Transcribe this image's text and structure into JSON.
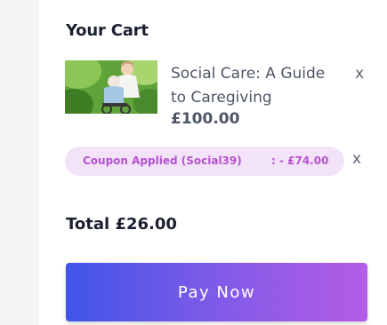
{
  "cart": {
    "title": "Your Cart",
    "item": {
      "name": "Social Care: A Guide to Caregiving",
      "price": "£100.00",
      "remove_label": "x",
      "image_icon": "caregiver-photo"
    },
    "coupon": {
      "label": "Coupon Applied (Social39)",
      "amount": ": - £74.00",
      "remove_label": "x"
    },
    "total": "Total £26.00",
    "pay_button_label": "Pay Now"
  },
  "colors": {
    "coupon_bg": "#f3e3f8",
    "coupon_text": "#b552cf",
    "button_gradient_start": "#3f55e8",
    "button_gradient_end": "#b55de6",
    "heading_text": "#1b2031"
  }
}
